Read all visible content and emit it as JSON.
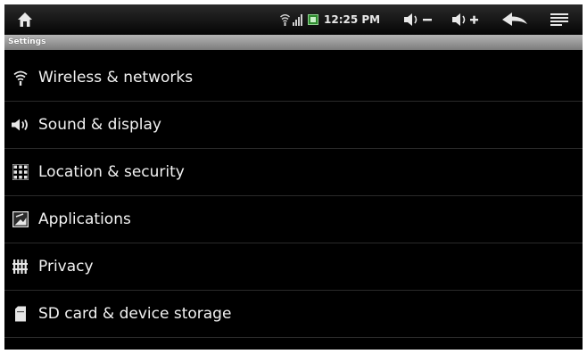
{
  "status_bar": {
    "time": "12:25 PM",
    "icons": {
      "home": "home-icon",
      "wifi": "wifi-icon",
      "signal": "signal-icon",
      "battery": "battery-icon",
      "volume_down": "volume-down-icon",
      "volume_up": "volume-up-icon",
      "back": "back-arrow-icon",
      "menu": "menu-icon"
    }
  },
  "header": {
    "title": "Settings"
  },
  "settings": {
    "items": [
      {
        "label": "Wireless & networks",
        "icon": "wifi-icon"
      },
      {
        "label": "Sound & display",
        "icon": "speaker-icon"
      },
      {
        "label": "Location & security",
        "icon": "grid-icon"
      },
      {
        "label": "Applications",
        "icon": "applications-icon"
      },
      {
        "label": "Privacy",
        "icon": "privacy-icon"
      },
      {
        "label": "SD card & device storage",
        "icon": "sd-card-icon"
      }
    ]
  },
  "colors": {
    "background": "#000000",
    "status_bar": "#1a1a1a",
    "title_bar": "#9a9a9a",
    "text": "#f2f2f2",
    "divider": "#2a2a2a"
  }
}
